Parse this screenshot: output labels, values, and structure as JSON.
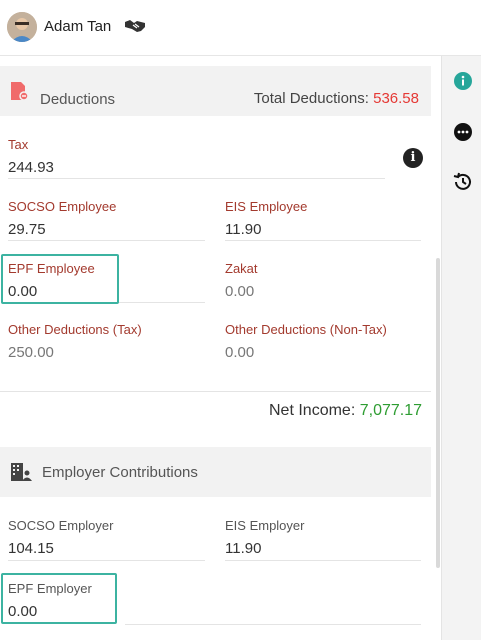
{
  "header": {
    "user_name": "Adam Tan"
  },
  "deductions": {
    "title": "Deductions",
    "total_label": "Total Deductions:",
    "total_value": "536.58",
    "fields": {
      "tax": {
        "label": "Tax",
        "value": "244.93"
      },
      "socso_employee": {
        "label": "SOCSO Employee",
        "value": "29.75"
      },
      "eis_employee": {
        "label": "EIS Employee",
        "value": "11.90"
      },
      "epf_employee": {
        "label": "EPF Employee",
        "value": "0.00"
      },
      "zakat": {
        "label": "Zakat",
        "value": "0.00"
      },
      "other_tax": {
        "label": "Other Deductions (Tax)",
        "value": "250.00"
      },
      "other_nontax": {
        "label": "Other Deductions (Non-Tax)",
        "value": "0.00"
      }
    }
  },
  "net_income": {
    "label": "Net Income:",
    "value": "7,077.17"
  },
  "employer": {
    "title": "Employer Contributions",
    "fields": {
      "socso_employer": {
        "label": "SOCSO Employer",
        "value": "104.15"
      },
      "eis_employer": {
        "label": "EIS Employer",
        "value": "11.90"
      },
      "epf_employer": {
        "label": "EPF Employer",
        "value": "0.00"
      }
    }
  },
  "colors": {
    "accent": "#26a69a",
    "danger": "#e53935",
    "positive": "#2e9d32",
    "highlight": "#3cb3a1"
  },
  "icons": {
    "rail": [
      "info-icon",
      "more-icon",
      "history-icon"
    ],
    "deductions": "receipt-minus-icon",
    "employer": "building-user-icon",
    "user": "handshake-icon"
  }
}
